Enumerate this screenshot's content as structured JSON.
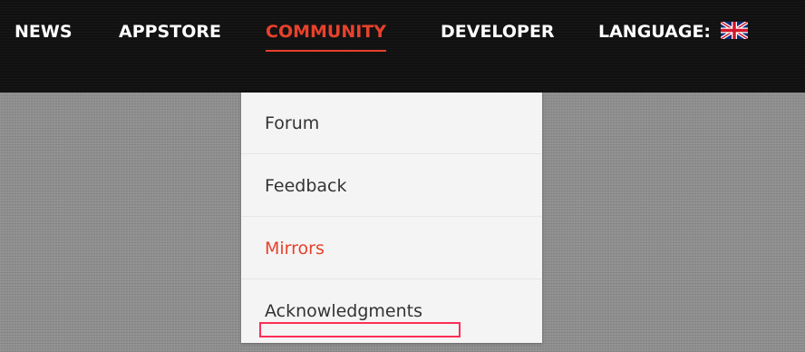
{
  "nav": {
    "items": [
      {
        "label": "NEWS"
      },
      {
        "label": "APPSTORE"
      },
      {
        "label": "COMMUNITY"
      },
      {
        "label": "DEVELOPER"
      },
      {
        "label": "LANGUAGE:"
      }
    ],
    "active_index": 2,
    "language_flag_icon": "uk-flag-icon"
  },
  "dropdown": {
    "items": [
      {
        "label": "Forum"
      },
      {
        "label": "Feedback"
      },
      {
        "label": "Mirrors"
      },
      {
        "label": "Acknowledgments"
      }
    ],
    "highlighted_index": 2
  },
  "colors": {
    "accent": "#e8412c",
    "navbar_bg": "#111111",
    "dropdown_bg": "#f4f4f4",
    "selection_outline": "#ff2d55",
    "page_bg": "#8f8f8f"
  }
}
